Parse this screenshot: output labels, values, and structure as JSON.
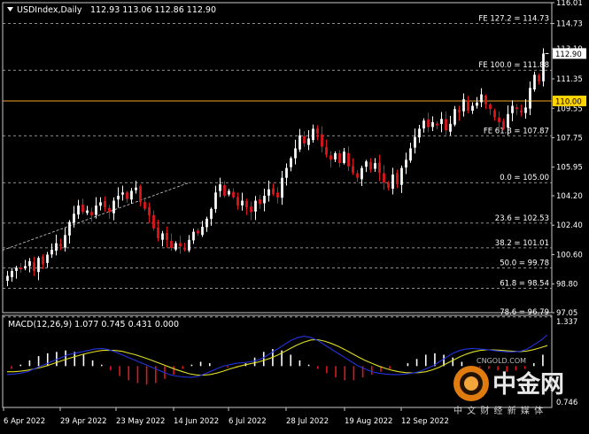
{
  "header": {
    "symbol": "USDIndex,Daily",
    "ohlc": "112.93 113.06 112.86 112.90"
  },
  "macd_header": "MACD(12,26,9) 1.077 0.745 0.431 0.000",
  "watermark": {
    "brand": "中金网",
    "url": "CNGOLD.COM",
    "tagline": "中 文 财 经 新 媒 体"
  },
  "colors": {
    "background": "#000000",
    "bull_candle": "#ffffff",
    "bear_candle": "#e0161b",
    "macd_line": "#2233dd",
    "signal_line": "#dddd22",
    "level_line": "#f5a623",
    "price_tag": "#ffffff",
    "level_tag": "#ffd400"
  },
  "chart_data": {
    "type": "candlestick",
    "price_axis": {
      "ylim": [
        97.05,
        116.01
      ],
      "ticks": [
        "116.01",
        "114.73",
        "113.19",
        "111.35",
        "109.55",
        "107.75",
        "105.95",
        "104.20",
        "102.40",
        "100.60",
        "98.80",
        "97.05"
      ],
      "tick_values": [
        116.01,
        114.73,
        113.19,
        111.35,
        109.55,
        107.75,
        105.95,
        104.2,
        102.4,
        100.6,
        98.8,
        97.05
      ],
      "current_price": "112.90",
      "level_label": "110.00"
    },
    "x_axis_labels": [
      "6 Apr 2022",
      "29 Apr 2022",
      "23 May 2022",
      "14 Jun 2022",
      "6 Jul 2022",
      "28 Jul 2022",
      "19 Aug 2022",
      "12 Sep 2022"
    ],
    "fib_levels": [
      {
        "label": "FE 127.2 = 114.73",
        "value": 114.73
      },
      {
        "label": "FE 100.0 = 111.88",
        "value": 111.88
      },
      {
        "label": "FE 61.8 = 107.87",
        "value": 107.87
      },
      {
        "label": "0.0 = 105.00",
        "value": 105.0
      },
      {
        "label": "23.6 = 102.53",
        "value": 102.53
      },
      {
        "label": "38.2 = 101.01",
        "value": 101.01
      },
      {
        "label": "50.0 = 99.78",
        "value": 99.78
      },
      {
        "label": "61.8 = 98.54",
        "value": 98.54
      },
      {
        "label": "78.6 = 96.79",
        "value": 96.79
      }
    ],
    "horizontal_level": 110.0,
    "trendline": {
      "from": [
        0,
        101.4
      ],
      "to": [
        41,
        105.0
      ]
    },
    "closes": [
      99.3,
      99.6,
      99.8,
      99.7,
      99.9,
      100.2,
      99.6,
      100.4,
      100.0,
      100.6,
      100.9,
      101.3,
      101.1,
      101.8,
      102.6,
      103.1,
      103.6,
      103.2,
      103.3,
      103.0,
      103.6,
      103.8,
      103.5,
      103.2,
      103.9,
      104.2,
      104.4,
      104.0,
      104.5,
      104.7,
      103.8,
      103.4,
      103.0,
      102.2,
      101.6,
      101.9,
      101.5,
      101.0,
      101.3,
      101.1,
      100.9,
      101.5,
      102.0,
      101.9,
      102.3,
      102.8,
      103.4,
      104.4,
      104.9,
      104.2,
      104.5,
      104.1,
      103.6,
      103.9,
      103.5,
      103.2,
      103.9,
      103.7,
      104.2,
      104.6,
      104.3,
      104.1,
      105.3,
      105.9,
      106.5,
      107.1,
      107.9,
      107.4,
      107.7,
      108.3,
      108.0,
      107.2,
      106.7,
      106.4,
      106.8,
      106.2,
      106.9,
      106.0,
      105.6,
      105.3,
      105.9,
      106.3,
      105.8,
      106.2,
      105.6,
      105.0,
      104.7,
      105.5,
      104.9,
      105.9,
      106.4,
      107.1,
      107.8,
      108.3,
      108.8,
      108.4,
      108.7,
      108.5,
      108.9,
      108.2,
      108.6,
      109.5,
      109.3,
      110.1,
      109.4,
      109.7,
      109.9,
      110.4,
      109.8,
      109.5,
      109.0,
      108.7,
      108.3,
      109.2,
      109.7,
      109.5,
      109.3,
      109.6,
      110.8,
      111.6,
      111.2,
      112.9
    ],
    "macd_panel": {
      "ylim": [
        -0.746,
        1.337
      ],
      "ticks": [
        "1.337",
        "0.746"
      ],
      "macd": [
        -0.3,
        -0.28,
        -0.25,
        -0.2,
        -0.1,
        0.0,
        0.1,
        0.2,
        0.3,
        0.4,
        0.45,
        0.5,
        0.55,
        0.6,
        0.62,
        0.58,
        0.5,
        0.4,
        0.3,
        0.2,
        0.1,
        0.0,
        -0.1,
        -0.2,
        -0.3,
        -0.35,
        -0.38,
        -0.4,
        -0.38,
        -0.3,
        -0.2,
        -0.1,
        0.0,
        0.05,
        0.1,
        0.12,
        0.15,
        0.2,
        0.3,
        0.45,
        0.6,
        0.75,
        0.9,
        1.0,
        1.05,
        1.0,
        0.9,
        0.75,
        0.6,
        0.45,
        0.3,
        0.15,
        0.0,
        -0.1,
        -0.2,
        -0.25,
        -0.28,
        -0.3,
        -0.3,
        -0.28,
        -0.25,
        -0.2,
        -0.1,
        0.0,
        0.15,
        0.3,
        0.45,
        0.55,
        0.6,
        0.62,
        0.6,
        0.58,
        0.55,
        0.52,
        0.5,
        0.5,
        0.52,
        0.6,
        0.75,
        0.9,
        1.1
      ],
      "signal": [
        -0.2,
        -0.2,
        -0.18,
        -0.15,
        -0.1,
        -0.05,
        0.02,
        0.1,
        0.18,
        0.26,
        0.33,
        0.4,
        0.46,
        0.51,
        0.55,
        0.56,
        0.55,
        0.52,
        0.46,
        0.4,
        0.32,
        0.24,
        0.15,
        0.06,
        -0.03,
        -0.12,
        -0.2,
        -0.27,
        -0.31,
        -0.32,
        -0.3,
        -0.25,
        -0.18,
        -0.1,
        -0.03,
        0.03,
        0.08,
        0.13,
        0.2,
        0.28,
        0.38,
        0.5,
        0.63,
        0.75,
        0.85,
        0.92,
        0.93,
        0.88,
        0.8,
        0.7,
        0.58,
        0.45,
        0.32,
        0.2,
        0.1,
        0.0,
        -0.08,
        -0.15,
        -0.2,
        -0.23,
        -0.24,
        -0.23,
        -0.2,
        -0.13,
        -0.04,
        0.08,
        0.2,
        0.32,
        0.42,
        0.5,
        0.55,
        0.57,
        0.57,
        0.56,
        0.54,
        0.52,
        0.51,
        0.53,
        0.58,
        0.65,
        0.72
      ],
      "histogram": [
        -0.1,
        0.05,
        0.2,
        0.35,
        0.45,
        0.5,
        0.55,
        0.5,
        0.4,
        0.2,
        0.05,
        -0.15,
        -0.35,
        -0.5,
        -0.6,
        -0.65,
        -0.6,
        -0.45,
        -0.3,
        -0.1,
        0.05,
        0.15,
        0.1,
        0.0,
        -0.05,
        -0.05,
        0.1,
        0.3,
        0.5,
        0.6,
        0.55,
        0.4,
        0.2,
        0.05,
        -0.1,
        -0.25,
        -0.4,
        -0.5,
        -0.5,
        -0.4,
        -0.3,
        -0.2,
        -0.1,
        0.0,
        0.1,
        0.25,
        0.4,
        0.45,
        0.4,
        0.3,
        0.15,
        0.0,
        -0.05,
        -0.1,
        -0.15,
        -0.2,
        -0.15,
        -0.1,
        0.1,
        0.4
      ]
    }
  }
}
